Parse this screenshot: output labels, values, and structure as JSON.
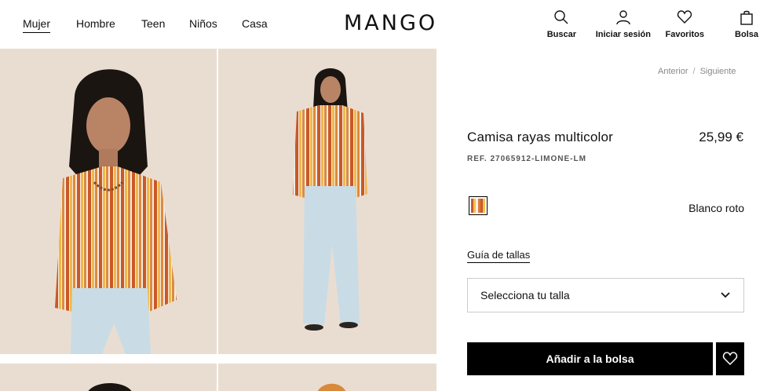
{
  "header": {
    "logo": "MANGO",
    "nav": [
      "Mujer",
      "Hombre",
      "Teen",
      "Niños",
      "Casa"
    ],
    "active_nav": "Mujer",
    "actions": {
      "search": "Buscar",
      "login": "Iniciar sesión",
      "favorites": "Favoritos",
      "bag": "Bolsa"
    }
  },
  "breadcrumb": {
    "prev": "Anterior",
    "separator": "/",
    "next": "Siguiente"
  },
  "product": {
    "title": "Camisa rayas multicolor",
    "price": "25,99 €",
    "ref": "REF. 27065912-LIMONE-LM",
    "color_name": "Blanco roto",
    "size_guide": "Guía de tallas",
    "size_placeholder": "Selecciona tu talla",
    "add_to_bag": "Añadir a la bolsa"
  },
  "colors": {
    "photo_bg": "#e9ddd2",
    "button_bg": "#000000",
    "text": "#111111"
  }
}
